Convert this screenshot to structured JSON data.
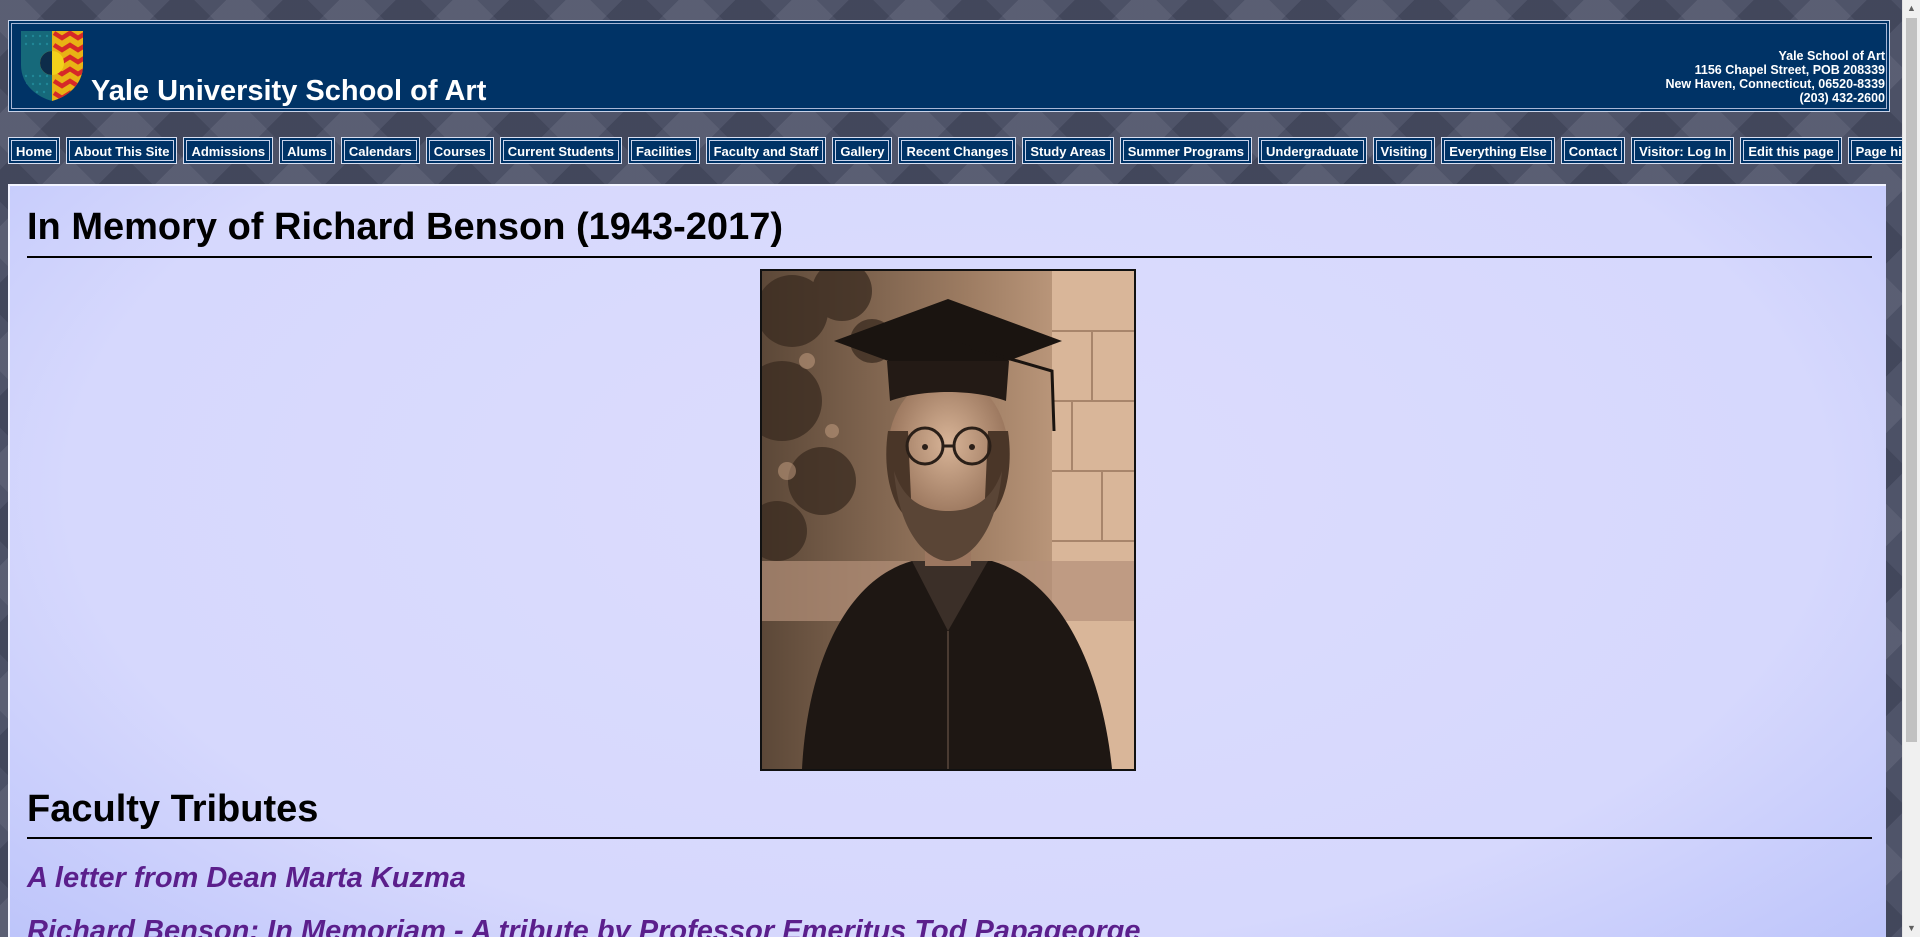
{
  "header": {
    "site_title": "Yale University School of Art",
    "address": [
      "Yale School of Art",
      "1156 Chapel Street, POB 208339",
      "New Haven, Connecticut, 06520-8339",
      "(203) 432-2600"
    ]
  },
  "nav": [
    "Home",
    "About This Site",
    "Admissions",
    "Alums",
    "Calendars",
    "Courses",
    "Current Students",
    "Facilities",
    "Faculty and Staff",
    "Gallery",
    "Recent Changes",
    "Study Areas",
    "Summer Programs",
    "Undergraduate",
    "Visiting",
    "Everything Else",
    "Contact",
    "Visitor: Log In",
    "Edit this page",
    "Page history"
  ],
  "main": {
    "heading": "In Memory of Richard Benson (1943-2017)",
    "section_heading": "Faculty Tributes",
    "links": [
      "A letter from Dean Marta Kuzma",
      "Richard Benson: In Memoriam - A tribute by Professor Emeritus Tod Papageorge"
    ]
  },
  "colors": {
    "banner": "#003366",
    "content_bg": "#d8dafd",
    "link": "#5b1f8c"
  }
}
